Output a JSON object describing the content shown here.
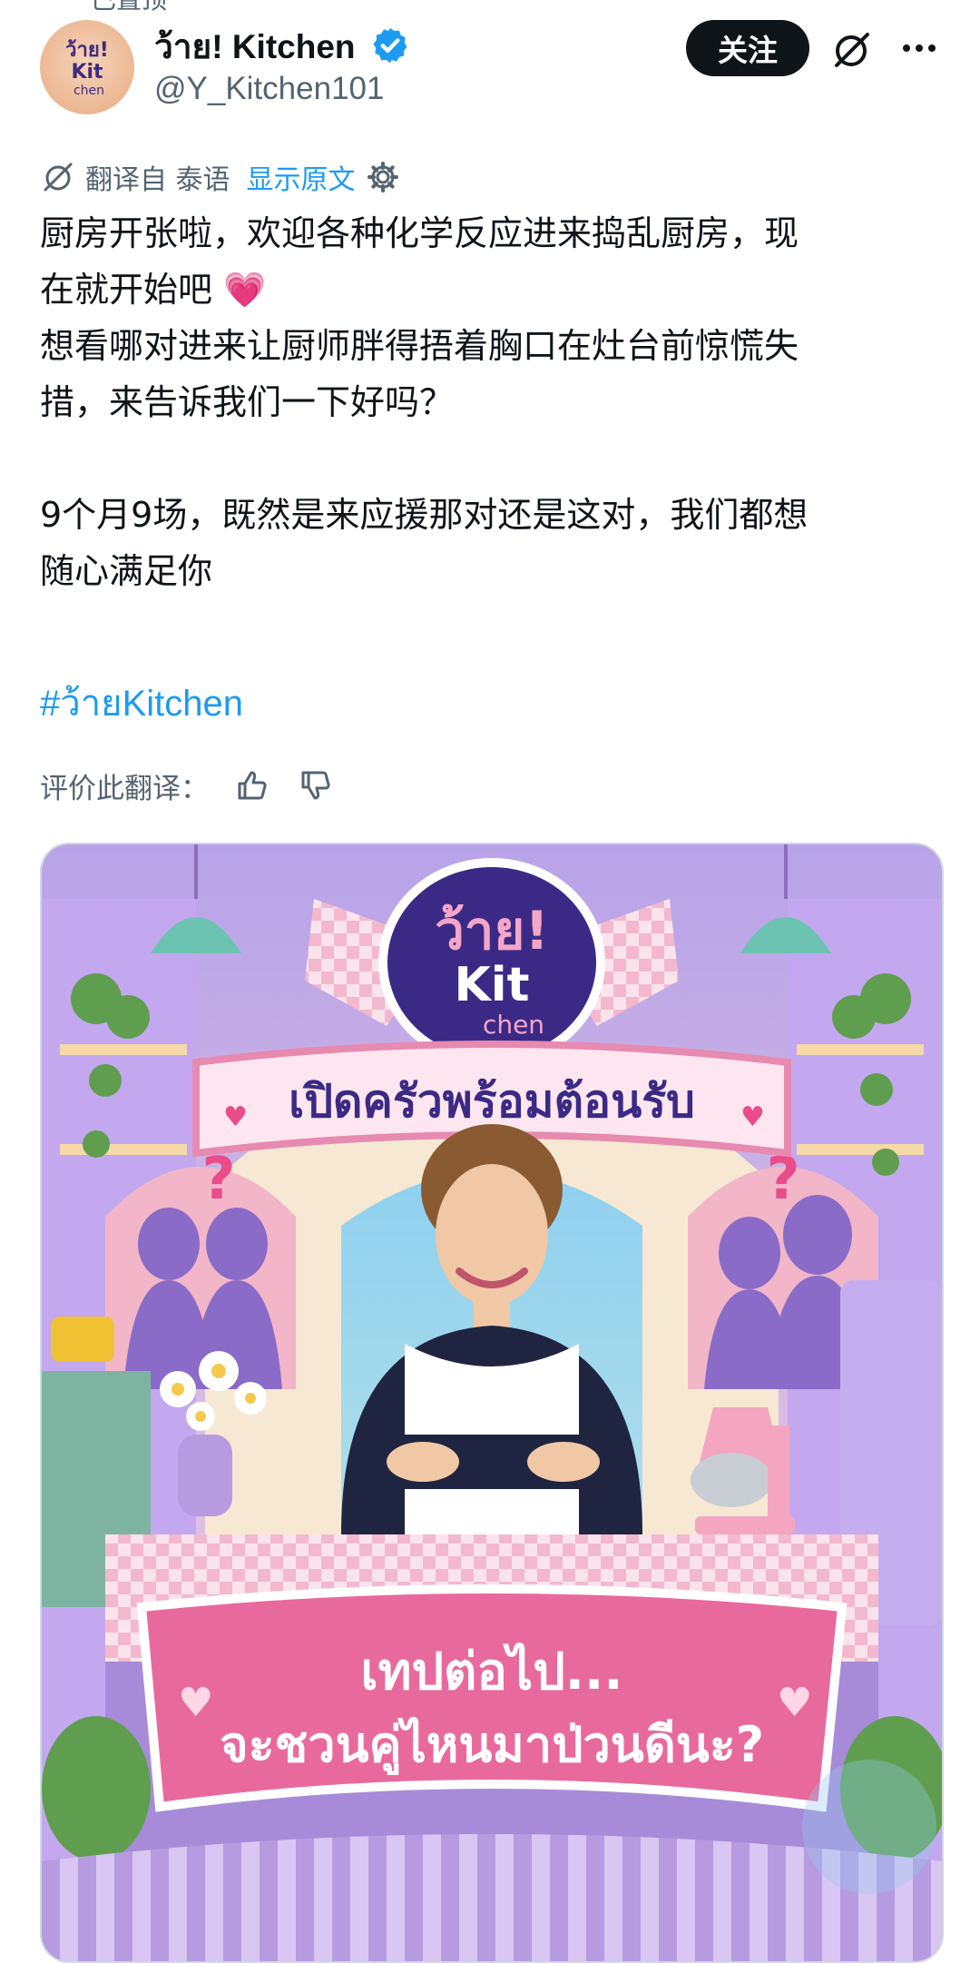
{
  "top_stub": "已置顶",
  "author": {
    "name": "ว้าย! Kitchen",
    "handle": "@Y_Kitchen101",
    "avatar_text": [
      "ว้าย!",
      "Kit",
      "chen"
    ]
  },
  "follow_label": "关注",
  "translation": {
    "source": "翻译自 泰语",
    "show_original": "显示原文"
  },
  "tweet": {
    "line1": "厨房开张啦，欢迎各种化学反应进来捣乱厨房，现",
    "line2": "在就开始吧 💗",
    "line3": "想看哪对进来让厨师胖得捂着胸口在灶台前惊慌失",
    "line4": "措，来告诉我们一下好吗？",
    "line5": "9个月9场，既然是来应援那对还是这对，我们都想",
    "line6": "随心满足你",
    "hashtag": "#ว้ายKitchen"
  },
  "rate_label": "评价此翻译：",
  "image": {
    "logo_lines": [
      "ว้าย!",
      "Kit",
      "chen"
    ],
    "banner_top": "เปิดครัวพร้อมต้อนรับ",
    "banner_bottom_line1": "เทปต่อไป...",
    "banner_bottom_line2": "จะชวนคู่ไหนมาป่วนดีนะ?",
    "question_mark": "?"
  },
  "colors": {
    "accent": "#1d9bf0",
    "text": "#0f1419",
    "muted": "#536471",
    "follow_bg": "#0f1419"
  }
}
